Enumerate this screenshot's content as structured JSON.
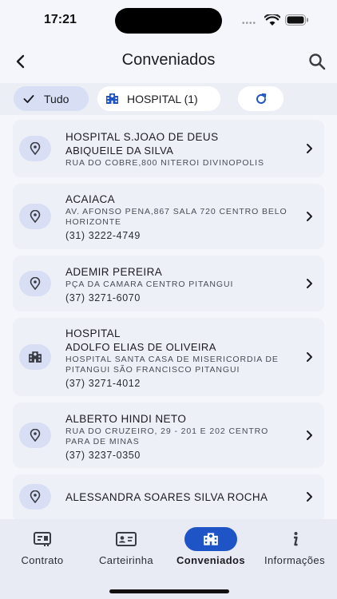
{
  "status": {
    "time": "17:21"
  },
  "header": {
    "title": "Conveniados"
  },
  "filters": {
    "all_label": "Tudo",
    "hospital_label": "HOSPITAL (1)"
  },
  "entries": [
    {
      "icon": "location-pin-icon",
      "name": "HOSPITAL S.JOAO DE DEUS",
      "sub": "ABIQUEILE DA SILVA",
      "address": "RUA DO COBRE,800 NITEROI DIVINOPOLIS",
      "phone": ""
    },
    {
      "icon": "location-pin-icon",
      "name": "ACAIACA",
      "sub": "",
      "address": "AV. AFONSO PENA,867  SALA 720 CENTRO BELO HORIZONTE",
      "phone": "(31) 3222-4749"
    },
    {
      "icon": "location-pin-icon",
      "name": "ADEMIR PEREIRA",
      "sub": "",
      "address": "PÇA DA CAMARA CENTRO PITANGUI",
      "phone": "(37) 3271-6070"
    },
    {
      "icon": "hospital-building-icon",
      "name": "HOSPITAL",
      "sub": "ADOLFO ELIAS DE OLIVEIRA",
      "address": "HOSPITAL SANTA CASA DE MISERICORDIA DE PITANGUI SÃO FRANCISCO PITANGUI",
      "phone": "(37) 3271-4012"
    },
    {
      "icon": "location-pin-icon",
      "name": "ALBERTO HINDI NETO",
      "sub": "",
      "address": "RUA DO CRUZEIRO, 29 - 201 E 202 CENTRO PARA DE MINAS",
      "phone": "(37) 3237-0350"
    },
    {
      "icon": "location-pin-icon",
      "name": "ALESSANDRA SOARES SILVA ROCHA",
      "sub": "",
      "address": "",
      "phone": ""
    }
  ],
  "tabs": [
    {
      "label": "Contrato",
      "icon": "contract-icon",
      "active": false
    },
    {
      "label": "Carteirinha",
      "icon": "id-card-icon",
      "active": false
    },
    {
      "label": "Conveniados",
      "icon": "hospital-building-icon",
      "active": true
    },
    {
      "label": "Informações",
      "icon": "info-icon",
      "active": false
    }
  ],
  "colors": {
    "accent": "#1e54c5",
    "chip_selected": "#d8def4",
    "card_bg": "#eef0f8"
  }
}
